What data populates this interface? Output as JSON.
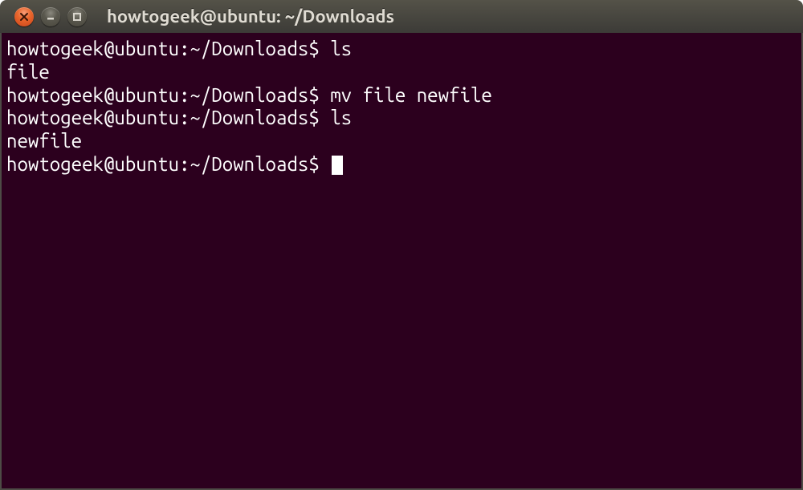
{
  "window": {
    "title": "howtogeek@ubuntu: ~/Downloads"
  },
  "prompt": "howtogeek@ubuntu:~/Downloads$ ",
  "session": [
    {
      "type": "cmd",
      "text": "ls"
    },
    {
      "type": "out",
      "text": "file"
    },
    {
      "type": "cmd",
      "text": "mv file newfile"
    },
    {
      "type": "cmd",
      "text": "ls"
    },
    {
      "type": "out",
      "text": "newfile"
    }
  ],
  "icons": {
    "close": "close-icon",
    "minimize": "minimize-icon",
    "maximize": "maximize-icon"
  }
}
